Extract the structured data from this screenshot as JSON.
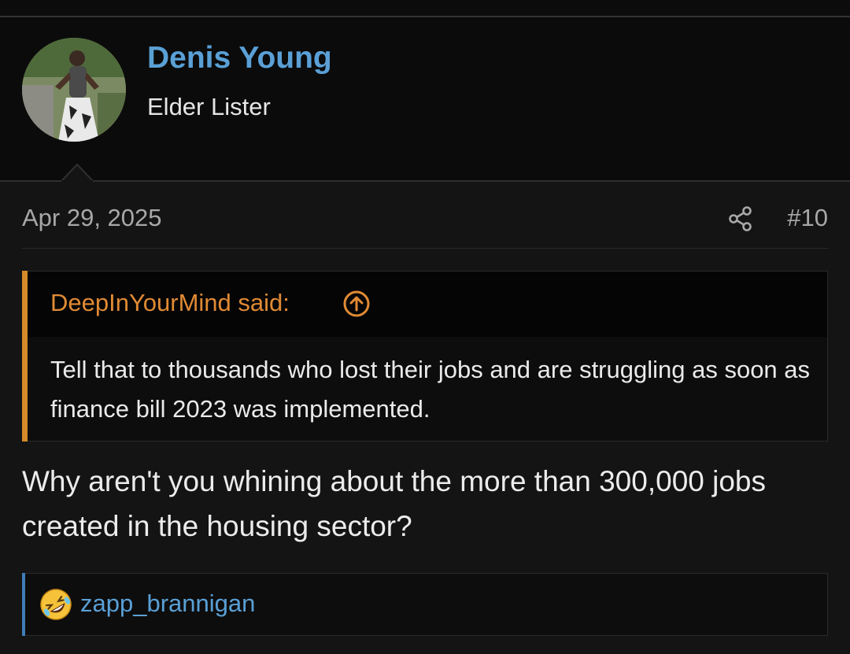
{
  "user": {
    "name": "Denis Young",
    "title": "Elder Lister"
  },
  "post": {
    "date": "Apr 29, 2025",
    "number": "#10",
    "text": "Why aren't you whining about the more than 300,000 jobs created in the housing sector?"
  },
  "quote": {
    "author_label": "DeepInYourMind said:",
    "text": "Tell that to thousands who lost their jobs and are struggling as soon as finance bill 2023 was implemented."
  },
  "reactions": {
    "emoji": "rolling-on-floor-laughing",
    "users": "zapp_brannigan"
  },
  "colors": {
    "background": "#141414",
    "header_background": "#0b0b0b",
    "username": "#5aa0d6",
    "quote_accent": "#d48a2a",
    "quote_author": "#e08a34",
    "reaction_accent": "#3f7db8"
  },
  "icons": {
    "share": "share-icon",
    "quote_jump": "arrow-up-circle-icon"
  }
}
